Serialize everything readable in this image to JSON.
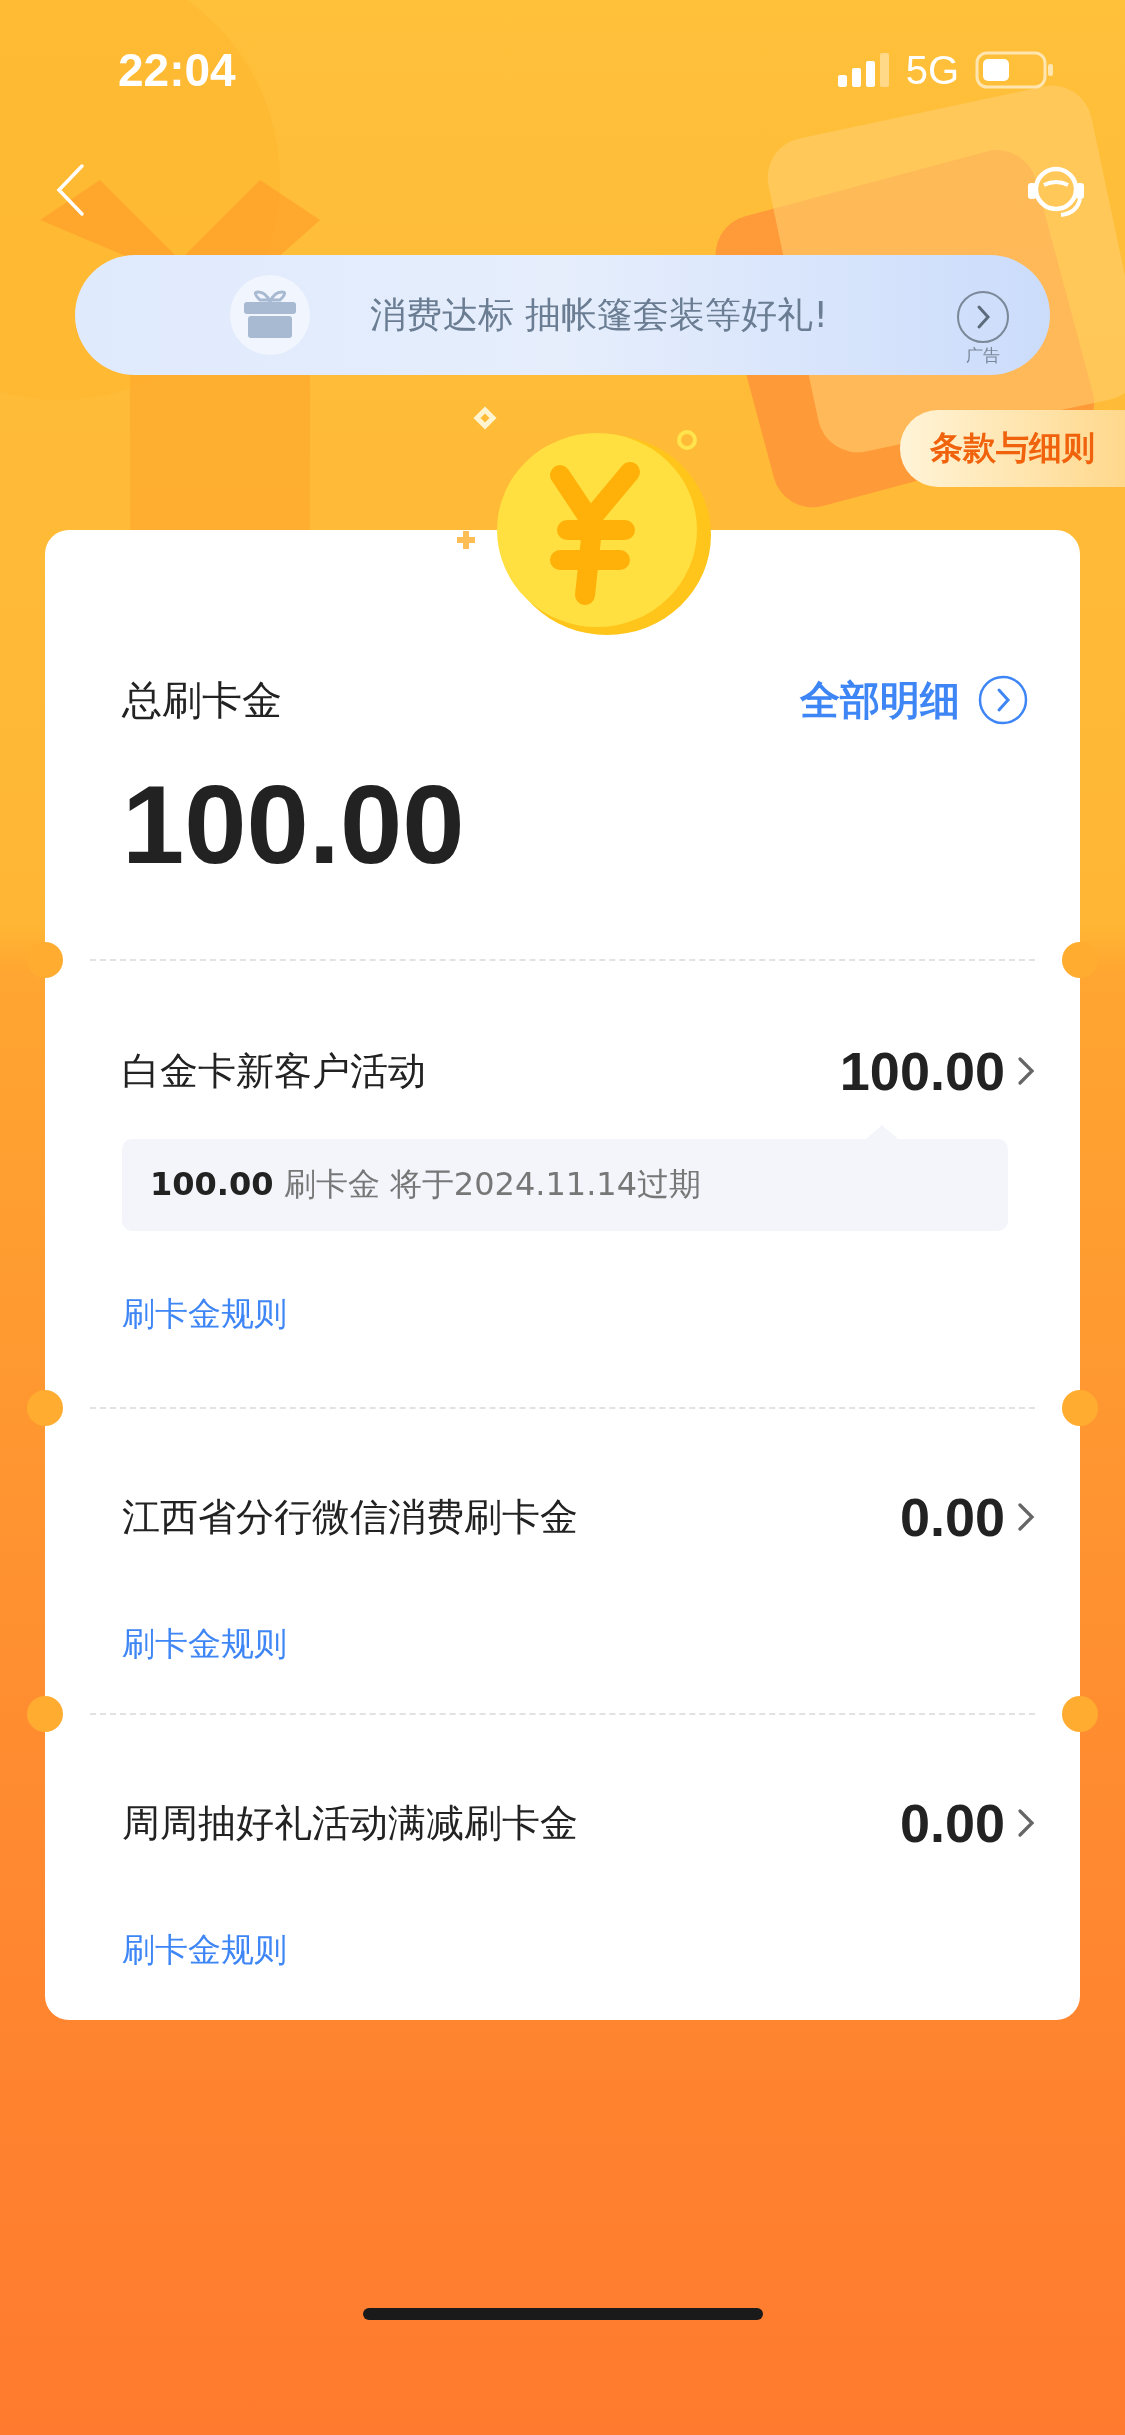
{
  "status_bar": {
    "time": "22:04",
    "network": "5G"
  },
  "banner": {
    "text": "消费达标 抽帐篷套装等好礼!",
    "ad_label": "广告"
  },
  "terms_button": "条款与细则",
  "summary": {
    "label": "总刷卡金",
    "details_link": "全部明细",
    "total": "100.00"
  },
  "activities": [
    {
      "title": "白金卡新客户活动",
      "amount": "100.00",
      "note": {
        "amount": "100.00",
        "text": "刷卡金 将于2024.11.14过期"
      },
      "rule_link": "刷卡金规则"
    },
    {
      "title": "江西省分行微信消费刷卡金",
      "amount": "0.00",
      "rule_link": "刷卡金规则"
    },
    {
      "title": "周周抽好礼活动满减刷卡金",
      "amount": "0.00",
      "rule_link": "刷卡金规则"
    }
  ]
}
